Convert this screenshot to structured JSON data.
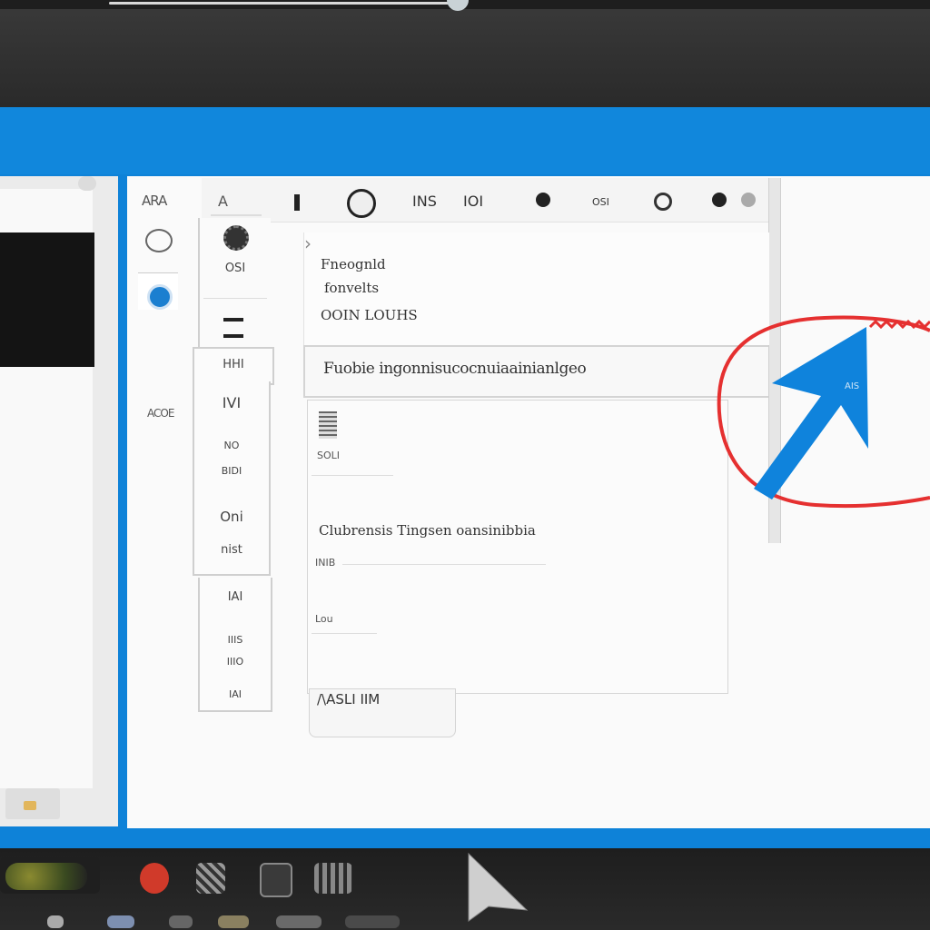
{
  "colors": {
    "accent": "#0e82d8",
    "annotation": "#e53030",
    "arrow": "#0f83dc"
  },
  "rail": {
    "label_top": "ARA",
    "label_mid": "ACOE"
  },
  "toolbar": {
    "item1": "A",
    "item2": "INS",
    "item3": "IOI",
    "item4": "OSI"
  },
  "panel": {
    "line1": "Fneognld",
    "line2": "fonvelts",
    "line3": "OOIN LOUHS"
  },
  "header_row": {
    "label": "Fuobie ingonnisucocnuiaainianlgeo"
  },
  "content": {
    "heading": "Clubrensis Tingsen oansinibbia",
    "line1": "INIB",
    "line2": "Lou",
    "line3": "SOLI"
  },
  "sidebar": {
    "item1": "OSI",
    "item2": "HHI",
    "item3": "IVI",
    "item4": "NO",
    "item5": "BIDI",
    "item6": "Oni",
    "item7": "nist",
    "item8": "IAI",
    "item9": "IIIS",
    "item10": "IIIO",
    "item11": "IAI"
  },
  "footer": {
    "label": "/\\ASLI IIM"
  },
  "annotation": {
    "badge": "AIS"
  },
  "icons": [
    "gear-icon",
    "dot-icon",
    "circle-icon",
    "arrow-cursor-icon",
    "close-icon"
  ]
}
